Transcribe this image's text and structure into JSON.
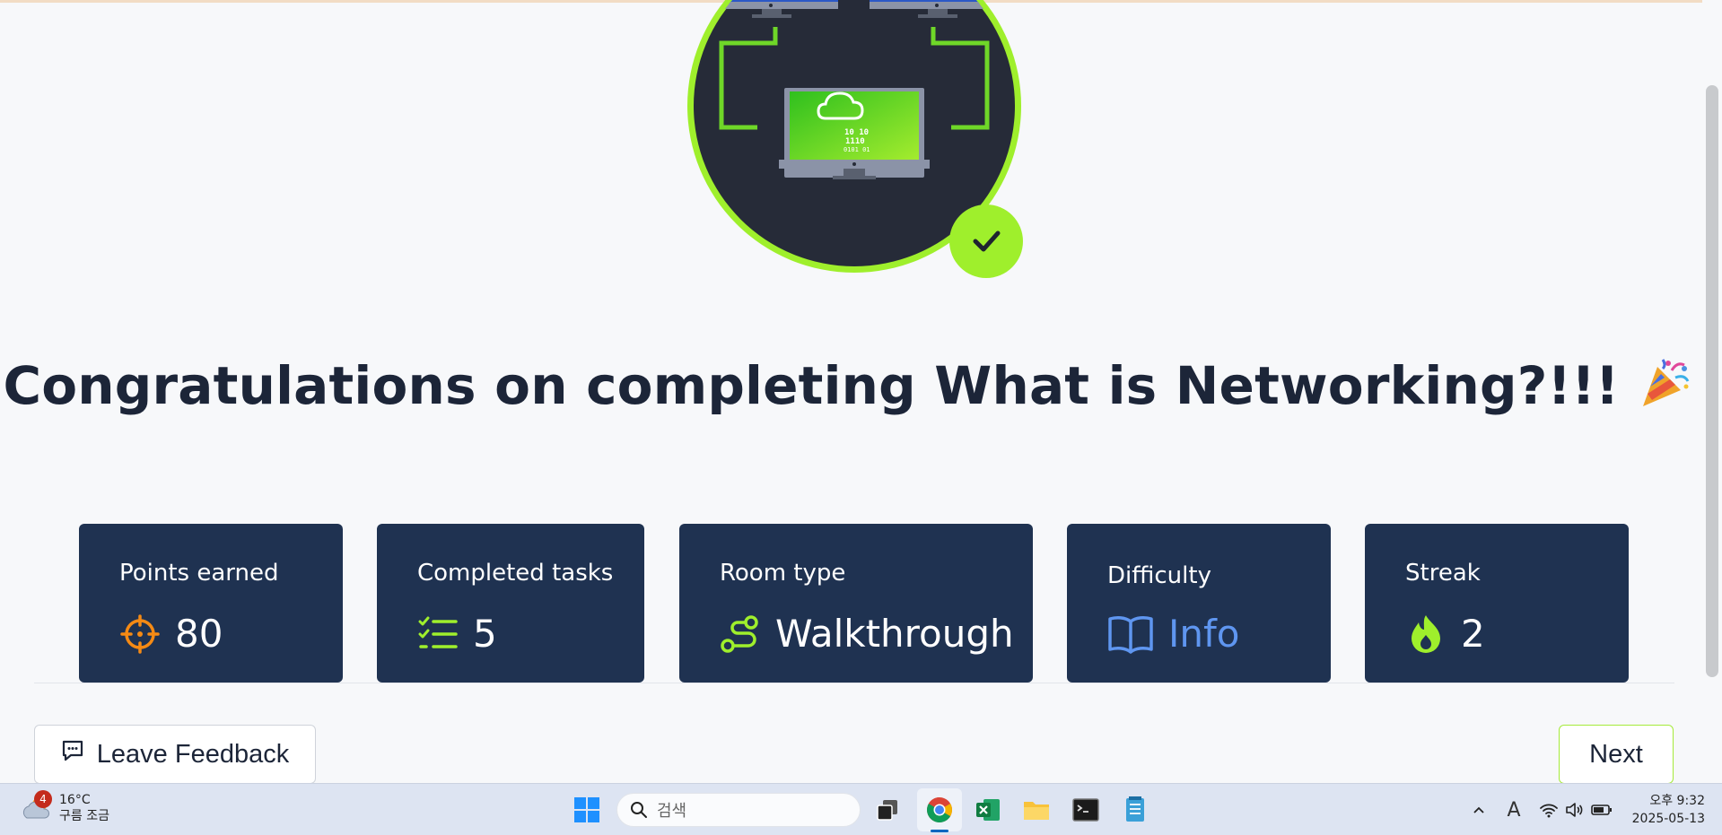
{
  "page": {
    "title": "Congratulations on completing What is Networking?!!!",
    "party_emoji": "🎉"
  },
  "stats": [
    {
      "label": "Points earned",
      "value": "80",
      "icon": "target-icon",
      "color": "#f58a14"
    },
    {
      "label": "Completed tasks",
      "value": "5",
      "icon": "checklist-icon",
      "color": "#9fef2c"
    },
    {
      "label": "Room type",
      "value": "Walkthrough",
      "icon": "route-icon",
      "color": "#9fef2c"
    },
    {
      "label": "Difficulty",
      "value": "Info",
      "icon": "book-icon",
      "color": "#5f96f0"
    },
    {
      "label": "Streak",
      "value": "2",
      "icon": "flame-icon",
      "color": "#9fef2c"
    }
  ],
  "actions": {
    "feedback_label": "Leave Feedback",
    "next_label": "Next"
  },
  "taskbar": {
    "weather_temp": "16°C",
    "weather_desc": "구름 조금",
    "notification_count": "4",
    "search_placeholder": "검색",
    "clock_time": "오후 9:32",
    "clock_date": "2025-05-13",
    "ime_label": "A"
  },
  "colors": {
    "accent": "#9fef2c",
    "card_bg": "#1f3251",
    "title": "#1c2538"
  }
}
